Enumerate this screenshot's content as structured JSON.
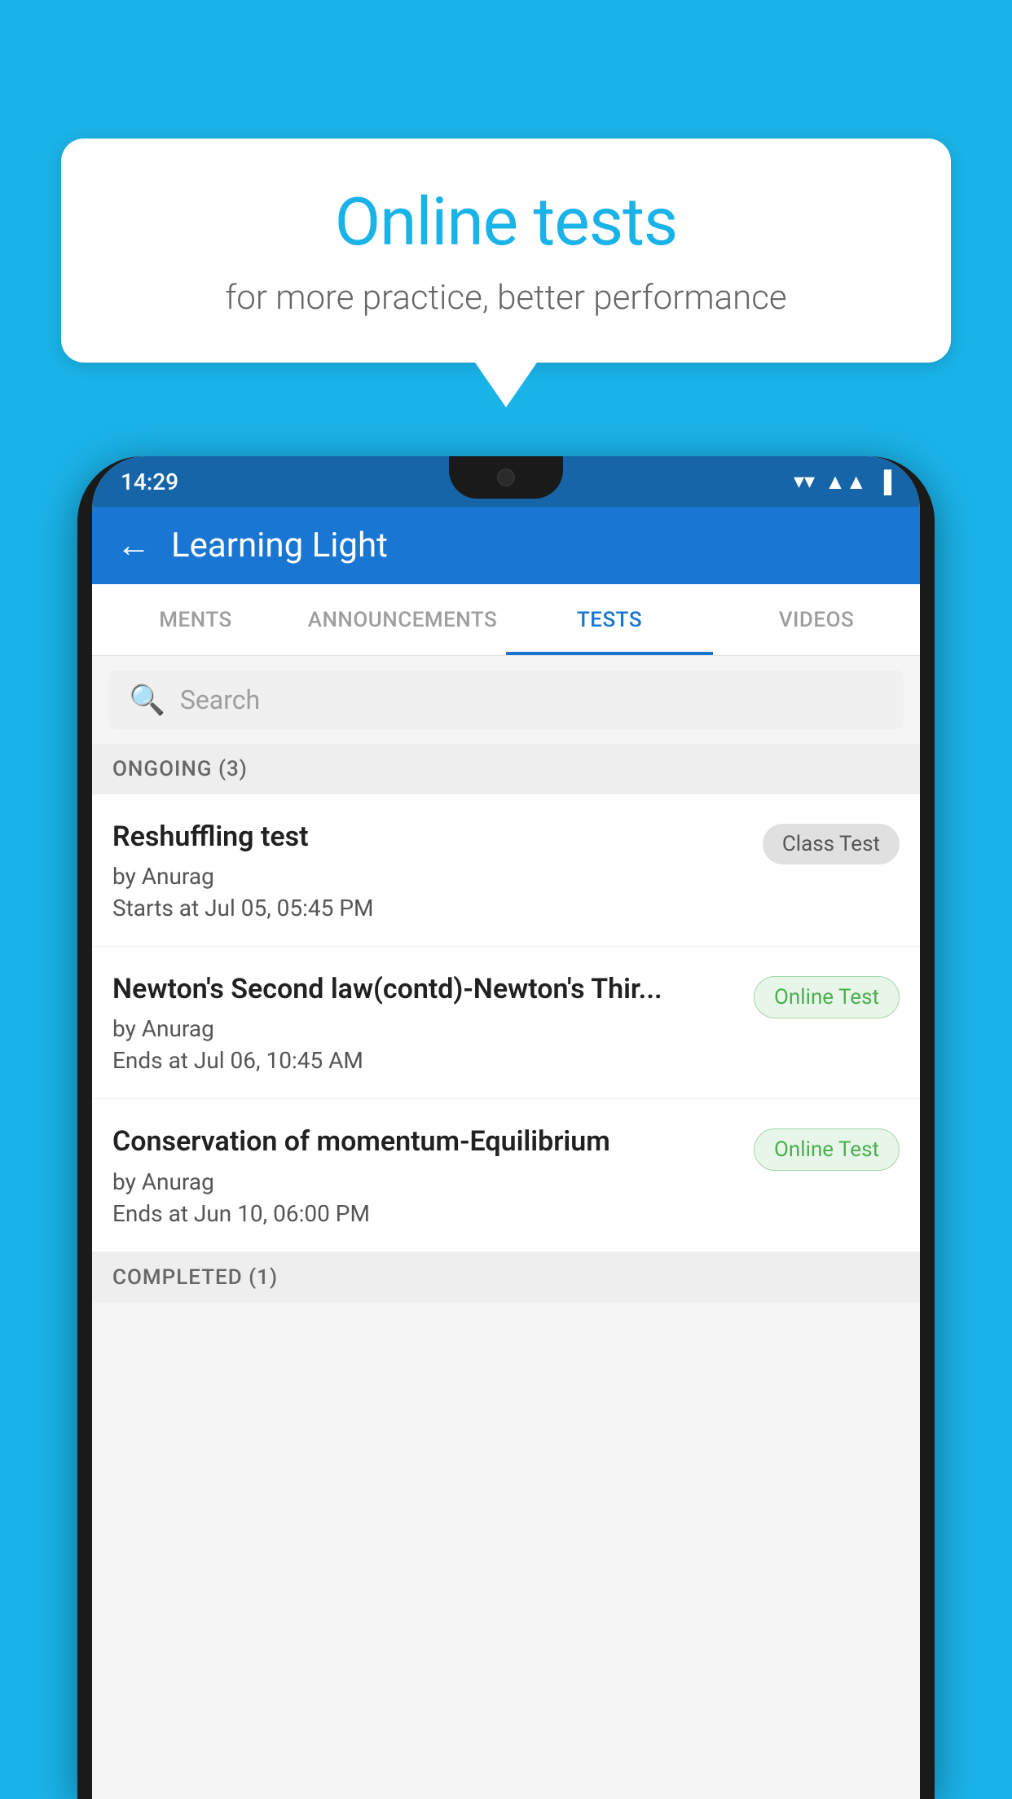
{
  "background_color": "#1ab3e8",
  "speech_bubble": {
    "title": "Online tests",
    "subtitle": "for more practice, better performance"
  },
  "status_bar": {
    "time": "14:29",
    "wifi": "▼",
    "signal": "▲",
    "battery": "▐"
  },
  "app_bar": {
    "back_label": "←",
    "title": "Learning Light"
  },
  "tabs": [
    {
      "label": "MENTS",
      "active": false
    },
    {
      "label": "ANNOUNCEMENTS",
      "active": false
    },
    {
      "label": "TESTS",
      "active": true
    },
    {
      "label": "VIDEOS",
      "active": false
    }
  ],
  "search": {
    "placeholder": "Search"
  },
  "ongoing_section": {
    "label": "ONGOING (3)",
    "tests": [
      {
        "name": "Reshuffling test",
        "author": "by Anurag",
        "date": "Starts at  Jul 05, 05:45 PM",
        "badge": "Class Test",
        "badge_type": "class"
      },
      {
        "name": "Newton's Second law(contd)-Newton's Thir...",
        "author": "by Anurag",
        "date": "Ends at  Jul 06, 10:45 AM",
        "badge": "Online Test",
        "badge_type": "online"
      },
      {
        "name": "Conservation of momentum-Equilibrium",
        "author": "by Anurag",
        "date": "Ends at  Jun 10, 06:00 PM",
        "badge": "Online Test",
        "badge_type": "online"
      }
    ]
  },
  "completed_section": {
    "label": "COMPLETED (1)"
  }
}
